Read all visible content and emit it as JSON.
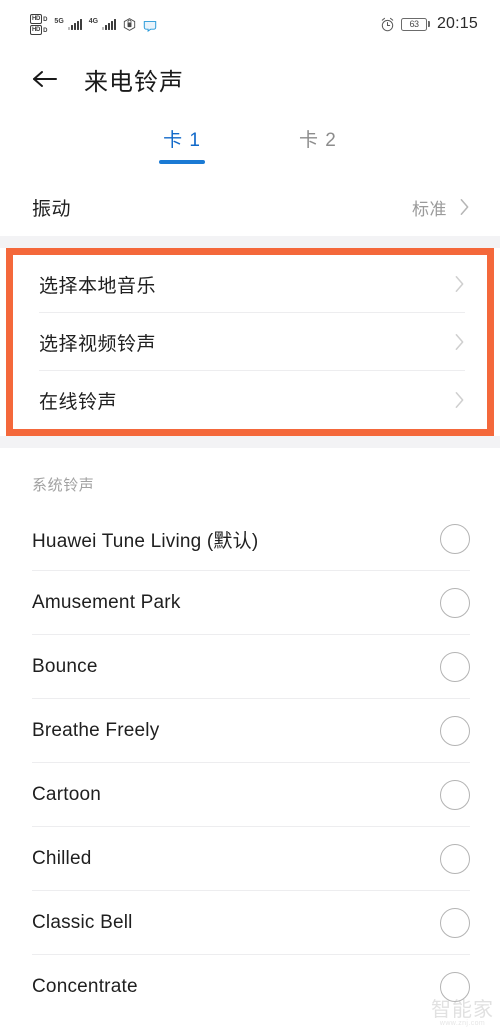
{
  "status_bar": {
    "hd_badge_top": "HD",
    "hd_badge_top_sub": "D",
    "hd_badge_bottom": "HD",
    "hd_badge_bottom_sub": "D",
    "network_1": "5G",
    "network_2": "4G",
    "battery_level": "63",
    "time": "20:15"
  },
  "header": {
    "title": "来电铃声",
    "back_icon": "back-arrow-icon"
  },
  "tabs": [
    {
      "label": "卡 1",
      "active": true
    },
    {
      "label": "卡 2",
      "active": false
    }
  ],
  "vibration": {
    "label": "振动",
    "value": "标准"
  },
  "highlight": {
    "border_color": "#f4683b",
    "items": [
      {
        "label": "选择本地音乐"
      },
      {
        "label": "选择视频铃声"
      },
      {
        "label": "在线铃声"
      }
    ]
  },
  "system_section": {
    "title": "系统铃声",
    "ringtones": [
      {
        "label": "Huawei Tune Living (默认)",
        "selected": false
      },
      {
        "label": "Amusement Park",
        "selected": false
      },
      {
        "label": "Bounce",
        "selected": false
      },
      {
        "label": "Breathe Freely",
        "selected": false
      },
      {
        "label": "Cartoon",
        "selected": false
      },
      {
        "label": "Chilled",
        "selected": false
      },
      {
        "label": "Classic Bell",
        "selected": false
      },
      {
        "label": "Concentrate",
        "selected": false
      }
    ]
  },
  "watermark": {
    "main": "智能家",
    "sub": "www.znj.com"
  },
  "colors": {
    "accent_blue": "#1a7ad4",
    "highlight_orange": "#f4683b",
    "gap_gray": "#f3f3f5"
  }
}
